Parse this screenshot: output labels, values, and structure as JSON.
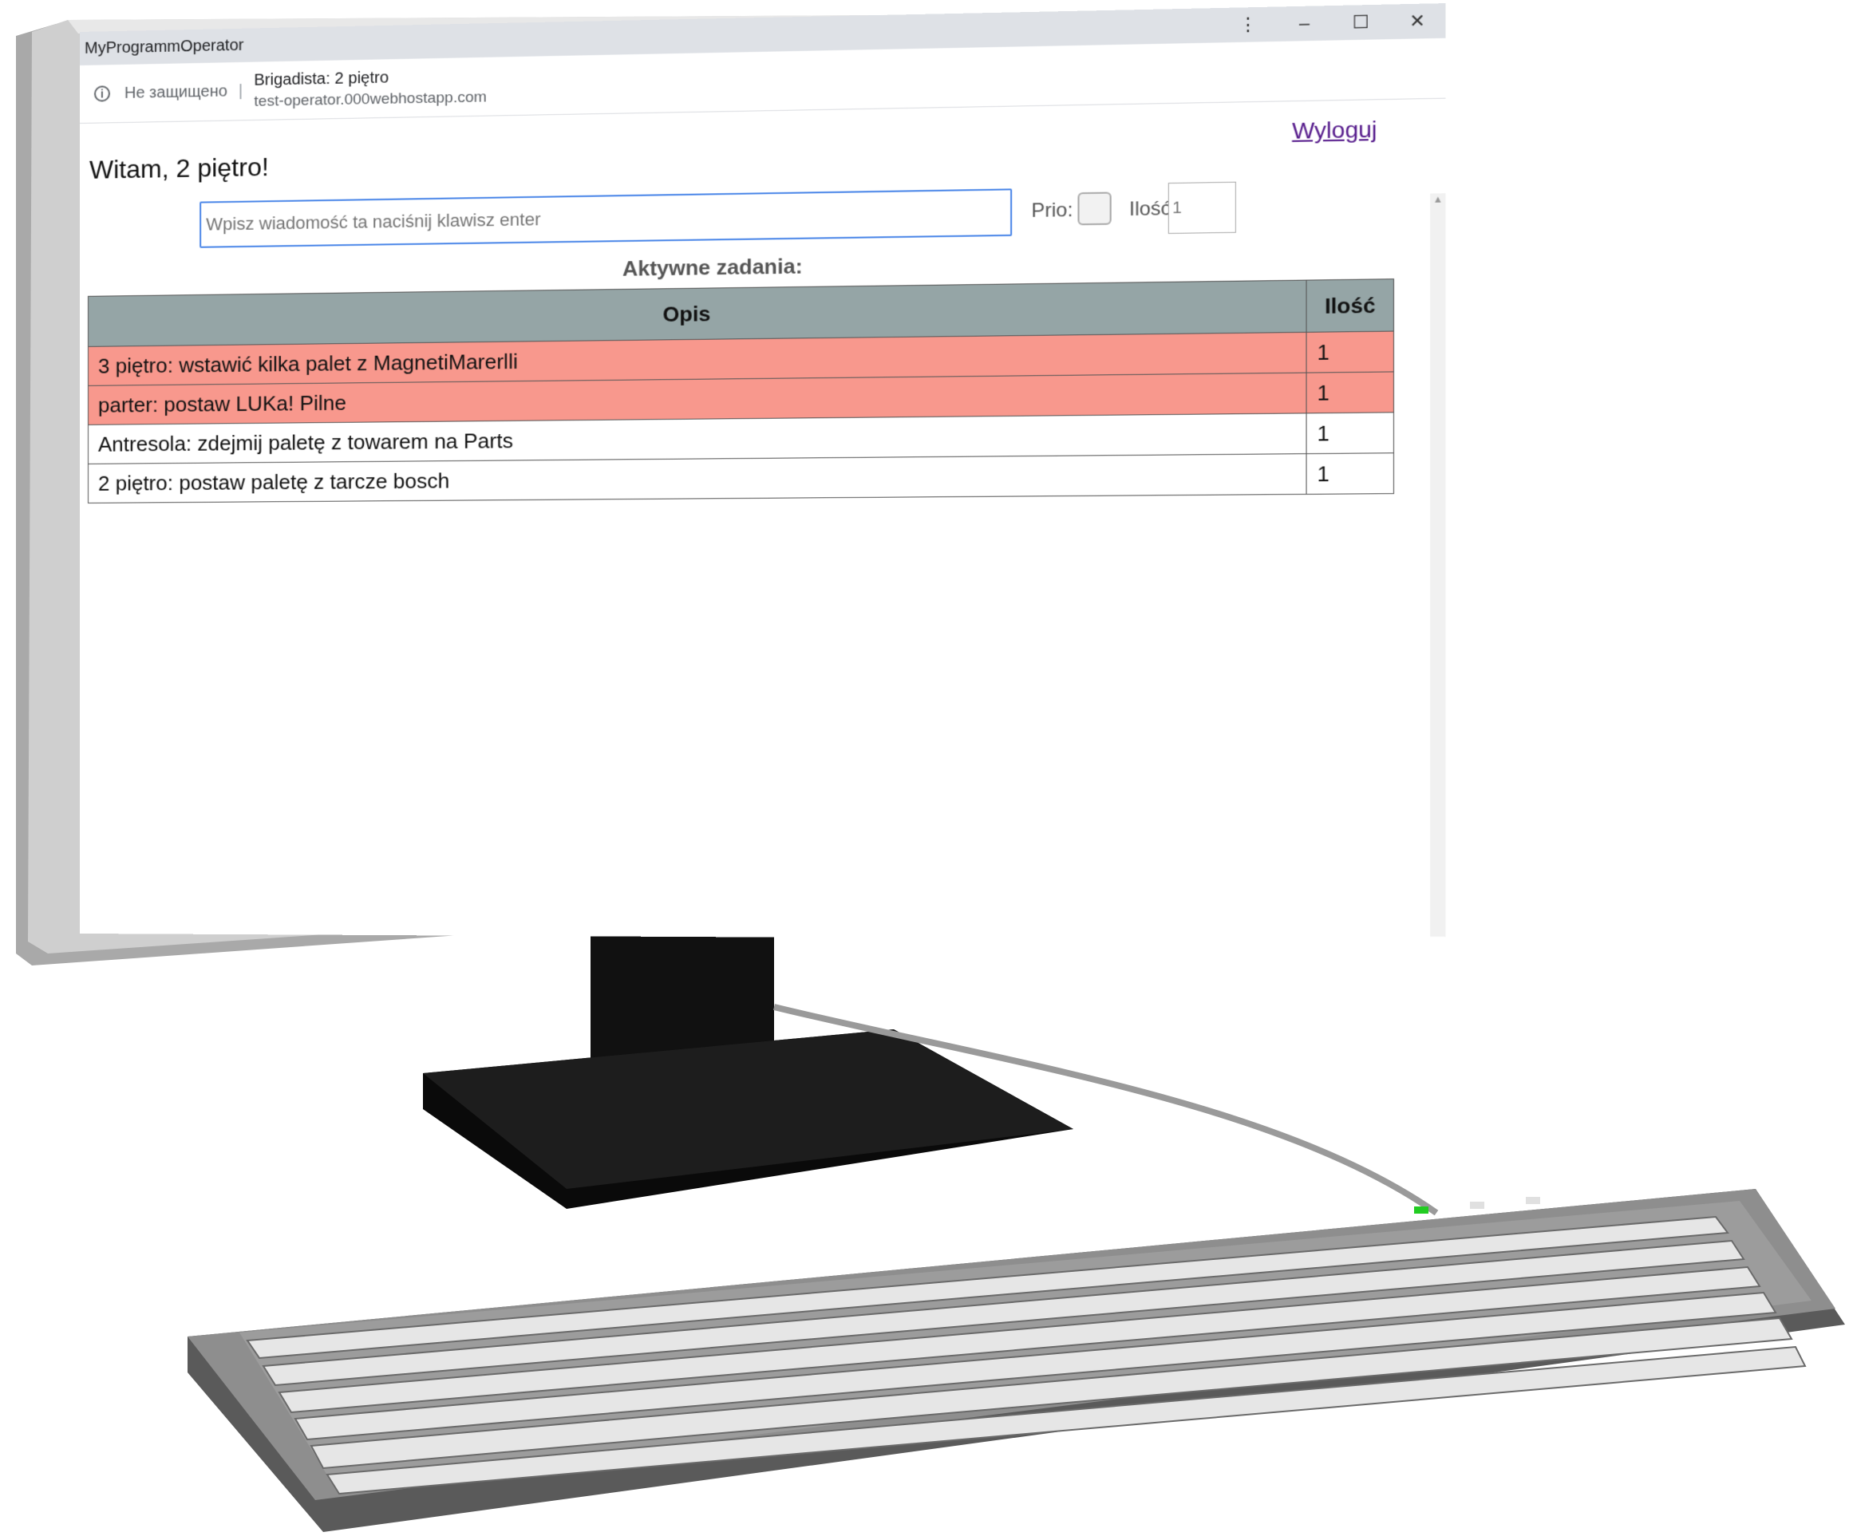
{
  "window": {
    "title": "MyProgrammOperator",
    "menu_icon": "more-vert-icon",
    "minimize_icon": "minimize-icon",
    "maximize_icon": "maximize-icon",
    "close_icon": "close-icon"
  },
  "address_bar": {
    "security_text": "Не защищено",
    "page_title": "Brigadista: 2 piętro",
    "url": "test-operator.000webhostapp.com"
  },
  "page": {
    "logout_label": "Wyloguj",
    "greeting": "Witam, 2 piętro!",
    "message_placeholder": "Wpisz wiadomość ta naciśnij klawisz enter",
    "prio_label": "Prio:",
    "qty_label": "Ilość",
    "qty_value": "1",
    "tasks_heading": "Aktywne zadania:"
  },
  "table": {
    "headers": [
      "Opis",
      "Ilość"
    ],
    "rows": [
      {
        "opis": "3 piętro: wstawić kilka palet z MagnetiMarerlli",
        "ilosc": "1",
        "prio": true
      },
      {
        "opis": "parter: postaw LUKa! Pilne",
        "ilosc": "1",
        "prio": true
      },
      {
        "opis": "Antresola: zdejmij paletę z towarem na Parts",
        "ilosc": "1",
        "prio": false
      },
      {
        "opis": "2 piętro: postaw paletę z tarcze bosch",
        "ilosc": "1",
        "prio": false
      }
    ]
  },
  "colors": {
    "prio_row": "#f8988d",
    "header_bg": "#95a5a6",
    "link": "#551a8b",
    "input_border": "#4a86e8",
    "led": "#22cc22"
  }
}
